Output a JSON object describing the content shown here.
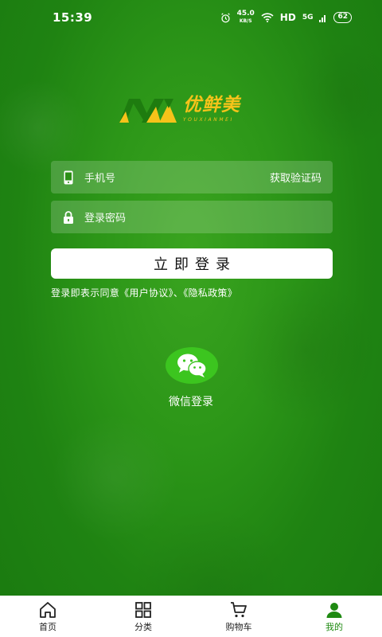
{
  "status_bar": {
    "time": "15:39",
    "net_speed_value": "45.0",
    "net_speed_unit": "KB/S",
    "hd": "HD",
    "signal": "5G",
    "battery": "62"
  },
  "logo": {
    "name_cn": "优鲜美",
    "name_en": "YOUXIANMEI",
    "colors": {
      "mark_green": "#1e7c0f",
      "mark_yellow": "#f6c31a"
    }
  },
  "form": {
    "phone_placeholder": "手机号",
    "get_code_label": "获取验证码",
    "password_placeholder": "登录密码",
    "login_label": "立即登录",
    "agreement_text": "登录即表示同意《用户协议》、《隐私政策》"
  },
  "wechat": {
    "label": "微信登录",
    "icon": "wechat-icon",
    "color": "#3cc51f"
  },
  "bottom_nav": {
    "items": [
      {
        "label": "首页",
        "icon": "home-icon",
        "active": false
      },
      {
        "label": "分类",
        "icon": "grid-icon",
        "active": false
      },
      {
        "label": "购物车",
        "icon": "cart-icon",
        "active": false
      },
      {
        "label": "我的",
        "icon": "user-icon",
        "active": true
      }
    ],
    "active_color": "#1f8a12"
  }
}
